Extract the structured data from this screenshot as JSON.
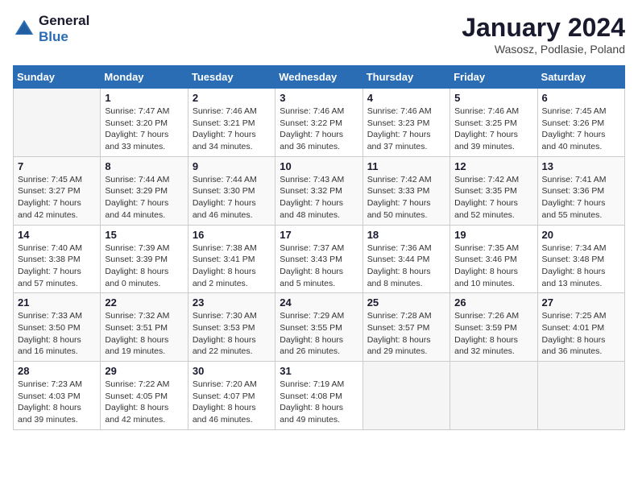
{
  "header": {
    "logo_line1": "General",
    "logo_line2": "Blue",
    "month": "January 2024",
    "location": "Wasosz, Podlasie, Poland"
  },
  "days_of_week": [
    "Sunday",
    "Monday",
    "Tuesday",
    "Wednesday",
    "Thursday",
    "Friday",
    "Saturday"
  ],
  "weeks": [
    [
      {
        "num": "",
        "sunrise": "",
        "sunset": "",
        "daylight": "",
        "empty": true
      },
      {
        "num": "1",
        "sunrise": "Sunrise: 7:47 AM",
        "sunset": "Sunset: 3:20 PM",
        "daylight": "Daylight: 7 hours and 33 minutes."
      },
      {
        "num": "2",
        "sunrise": "Sunrise: 7:46 AM",
        "sunset": "Sunset: 3:21 PM",
        "daylight": "Daylight: 7 hours and 34 minutes."
      },
      {
        "num": "3",
        "sunrise": "Sunrise: 7:46 AM",
        "sunset": "Sunset: 3:22 PM",
        "daylight": "Daylight: 7 hours and 36 minutes."
      },
      {
        "num": "4",
        "sunrise": "Sunrise: 7:46 AM",
        "sunset": "Sunset: 3:23 PM",
        "daylight": "Daylight: 7 hours and 37 minutes."
      },
      {
        "num": "5",
        "sunrise": "Sunrise: 7:46 AM",
        "sunset": "Sunset: 3:25 PM",
        "daylight": "Daylight: 7 hours and 39 minutes."
      },
      {
        "num": "6",
        "sunrise": "Sunrise: 7:45 AM",
        "sunset": "Sunset: 3:26 PM",
        "daylight": "Daylight: 7 hours and 40 minutes."
      }
    ],
    [
      {
        "num": "7",
        "sunrise": "Sunrise: 7:45 AM",
        "sunset": "Sunset: 3:27 PM",
        "daylight": "Daylight: 7 hours and 42 minutes."
      },
      {
        "num": "8",
        "sunrise": "Sunrise: 7:44 AM",
        "sunset": "Sunset: 3:29 PM",
        "daylight": "Daylight: 7 hours and 44 minutes."
      },
      {
        "num": "9",
        "sunrise": "Sunrise: 7:44 AM",
        "sunset": "Sunset: 3:30 PM",
        "daylight": "Daylight: 7 hours and 46 minutes."
      },
      {
        "num": "10",
        "sunrise": "Sunrise: 7:43 AM",
        "sunset": "Sunset: 3:32 PM",
        "daylight": "Daylight: 7 hours and 48 minutes."
      },
      {
        "num": "11",
        "sunrise": "Sunrise: 7:42 AM",
        "sunset": "Sunset: 3:33 PM",
        "daylight": "Daylight: 7 hours and 50 minutes."
      },
      {
        "num": "12",
        "sunrise": "Sunrise: 7:42 AM",
        "sunset": "Sunset: 3:35 PM",
        "daylight": "Daylight: 7 hours and 52 minutes."
      },
      {
        "num": "13",
        "sunrise": "Sunrise: 7:41 AM",
        "sunset": "Sunset: 3:36 PM",
        "daylight": "Daylight: 7 hours and 55 minutes."
      }
    ],
    [
      {
        "num": "14",
        "sunrise": "Sunrise: 7:40 AM",
        "sunset": "Sunset: 3:38 PM",
        "daylight": "Daylight: 7 hours and 57 minutes."
      },
      {
        "num": "15",
        "sunrise": "Sunrise: 7:39 AM",
        "sunset": "Sunset: 3:39 PM",
        "daylight": "Daylight: 8 hours and 0 minutes."
      },
      {
        "num": "16",
        "sunrise": "Sunrise: 7:38 AM",
        "sunset": "Sunset: 3:41 PM",
        "daylight": "Daylight: 8 hours and 2 minutes."
      },
      {
        "num": "17",
        "sunrise": "Sunrise: 7:37 AM",
        "sunset": "Sunset: 3:43 PM",
        "daylight": "Daylight: 8 hours and 5 minutes."
      },
      {
        "num": "18",
        "sunrise": "Sunrise: 7:36 AM",
        "sunset": "Sunset: 3:44 PM",
        "daylight": "Daylight: 8 hours and 8 minutes."
      },
      {
        "num": "19",
        "sunrise": "Sunrise: 7:35 AM",
        "sunset": "Sunset: 3:46 PM",
        "daylight": "Daylight: 8 hours and 10 minutes."
      },
      {
        "num": "20",
        "sunrise": "Sunrise: 7:34 AM",
        "sunset": "Sunset: 3:48 PM",
        "daylight": "Daylight: 8 hours and 13 minutes."
      }
    ],
    [
      {
        "num": "21",
        "sunrise": "Sunrise: 7:33 AM",
        "sunset": "Sunset: 3:50 PM",
        "daylight": "Daylight: 8 hours and 16 minutes."
      },
      {
        "num": "22",
        "sunrise": "Sunrise: 7:32 AM",
        "sunset": "Sunset: 3:51 PM",
        "daylight": "Daylight: 8 hours and 19 minutes."
      },
      {
        "num": "23",
        "sunrise": "Sunrise: 7:30 AM",
        "sunset": "Sunset: 3:53 PM",
        "daylight": "Daylight: 8 hours and 22 minutes."
      },
      {
        "num": "24",
        "sunrise": "Sunrise: 7:29 AM",
        "sunset": "Sunset: 3:55 PM",
        "daylight": "Daylight: 8 hours and 26 minutes."
      },
      {
        "num": "25",
        "sunrise": "Sunrise: 7:28 AM",
        "sunset": "Sunset: 3:57 PM",
        "daylight": "Daylight: 8 hours and 29 minutes."
      },
      {
        "num": "26",
        "sunrise": "Sunrise: 7:26 AM",
        "sunset": "Sunset: 3:59 PM",
        "daylight": "Daylight: 8 hours and 32 minutes."
      },
      {
        "num": "27",
        "sunrise": "Sunrise: 7:25 AM",
        "sunset": "Sunset: 4:01 PM",
        "daylight": "Daylight: 8 hours and 36 minutes."
      }
    ],
    [
      {
        "num": "28",
        "sunrise": "Sunrise: 7:23 AM",
        "sunset": "Sunset: 4:03 PM",
        "daylight": "Daylight: 8 hours and 39 minutes."
      },
      {
        "num": "29",
        "sunrise": "Sunrise: 7:22 AM",
        "sunset": "Sunset: 4:05 PM",
        "daylight": "Daylight: 8 hours and 42 minutes."
      },
      {
        "num": "30",
        "sunrise": "Sunrise: 7:20 AM",
        "sunset": "Sunset: 4:07 PM",
        "daylight": "Daylight: 8 hours and 46 minutes."
      },
      {
        "num": "31",
        "sunrise": "Sunrise: 7:19 AM",
        "sunset": "Sunset: 4:08 PM",
        "daylight": "Daylight: 8 hours and 49 minutes."
      },
      {
        "num": "",
        "sunrise": "",
        "sunset": "",
        "daylight": "",
        "empty": true
      },
      {
        "num": "",
        "sunrise": "",
        "sunset": "",
        "daylight": "",
        "empty": true
      },
      {
        "num": "",
        "sunrise": "",
        "sunset": "",
        "daylight": "",
        "empty": true
      }
    ]
  ]
}
